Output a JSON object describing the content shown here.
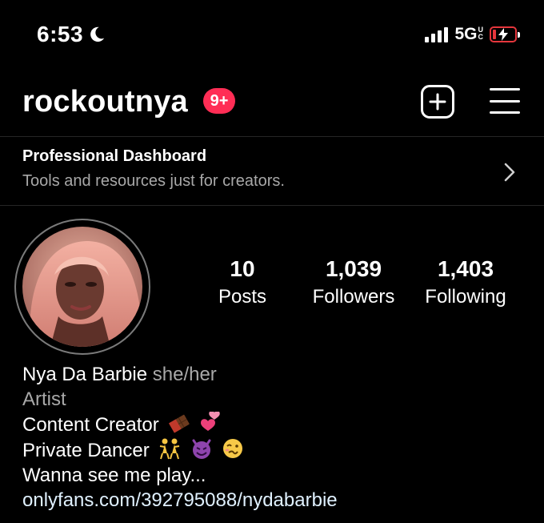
{
  "status_bar": {
    "time": "6:53",
    "network": "5G",
    "network_superscript": [
      "U",
      "C"
    ],
    "battery_color": "#e5363c"
  },
  "header": {
    "username": "rockoutnya",
    "notification_badge": "9+",
    "badge_color": "#ff2d55",
    "add_icon": "plus-square-icon",
    "menu_icon": "hamburger-menu-icon"
  },
  "dashboard": {
    "title": "Professional Dashboard",
    "subtitle": "Tools and resources just for creators."
  },
  "profile": {
    "stats": [
      {
        "value": "10",
        "label": "Posts"
      },
      {
        "value": "1,039",
        "label": "Followers"
      },
      {
        "value": "1,403",
        "label": "Following"
      }
    ],
    "display_name": "Nya Da Barbie",
    "pronouns": "she/her",
    "category": "Artist",
    "bio_lines": [
      "Content Creator",
      "Private Dancer",
      "Wanna see me play..."
    ],
    "link": "onlyfans.com/392795088/nydabarbie"
  }
}
